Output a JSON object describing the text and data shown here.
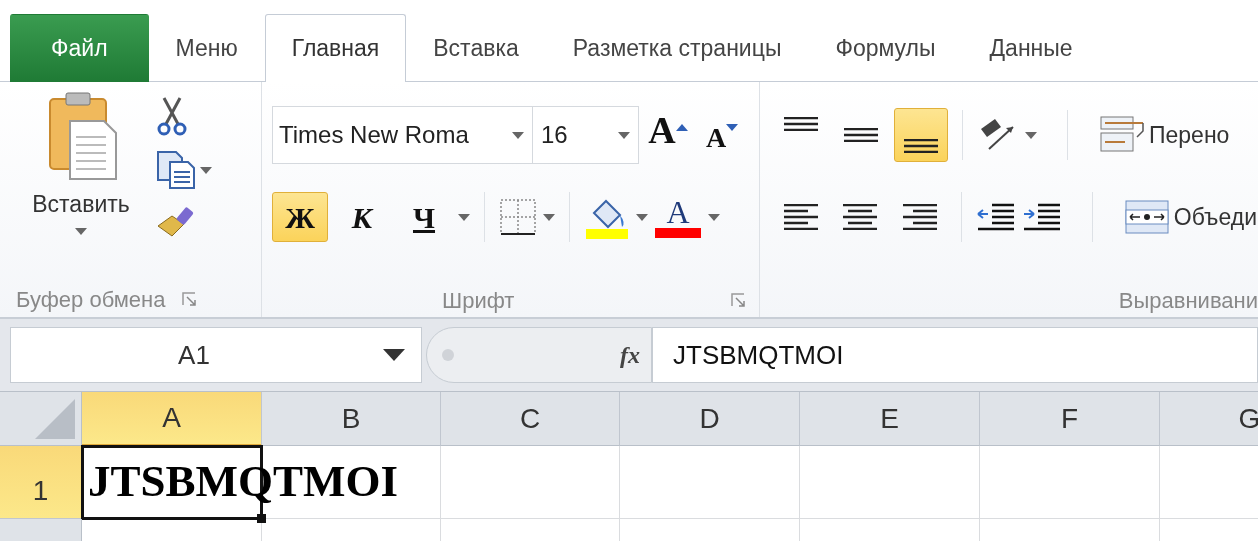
{
  "tabs": [
    {
      "label": "Файл",
      "kind": "file",
      "selected": false
    },
    {
      "label": "Меню",
      "kind": "tab",
      "selected": false
    },
    {
      "label": "Главная",
      "kind": "tab",
      "selected": true
    },
    {
      "label": "Вставка",
      "kind": "tab",
      "selected": false
    },
    {
      "label": "Разметка страницы",
      "kind": "tab",
      "selected": false
    },
    {
      "label": "Формулы",
      "kind": "tab",
      "selected": false
    },
    {
      "label": "Данные",
      "kind": "tab",
      "selected": false
    }
  ],
  "ribbon": {
    "clipboard": {
      "paste_label": "Вставить",
      "title": "Буфер обмена"
    },
    "font": {
      "font_name": "Times New Roma",
      "font_size": "16",
      "grow_label": "A",
      "shrink_label": "A",
      "styles": [
        {
          "kind": "bold",
          "label": "Ж",
          "selected": true
        },
        {
          "kind": "italic",
          "label": "К",
          "selected": false
        },
        {
          "kind": "underline",
          "label": "Ч",
          "selected": false
        }
      ],
      "font_color_label": "A",
      "title": "Шрифт"
    },
    "alignment": {
      "vertical": [
        {
          "kind": "top",
          "selected": false
        },
        {
          "kind": "middle",
          "selected": false
        },
        {
          "kind": "bottom",
          "selected": true
        }
      ],
      "horizontal": [
        {
          "kind": "left",
          "selected": false
        },
        {
          "kind": "center",
          "selected": false
        },
        {
          "kind": "right",
          "selected": false
        }
      ],
      "wrap_label": "Перено",
      "merge_label": "Объеди",
      "title": "Выравнивани"
    }
  },
  "formula_bar": {
    "name_box": "A1",
    "fx_label": "fx",
    "formula": "JTSBMQTMOI"
  },
  "grid": {
    "columns": [
      {
        "label": "A",
        "selected": true
      },
      {
        "label": "B",
        "selected": false
      },
      {
        "label": "C",
        "selected": false
      },
      {
        "label": "D",
        "selected": false
      },
      {
        "label": "E",
        "selected": false
      },
      {
        "label": "F",
        "selected": false
      },
      {
        "label": "G",
        "selected": false
      }
    ],
    "rows": [
      {
        "label": "1",
        "selected": true,
        "cells": [
          {
            "value": "JTSBMQTMOI",
            "active": true
          }
        ]
      },
      {
        "selected": false,
        "cells": []
      }
    ]
  }
}
